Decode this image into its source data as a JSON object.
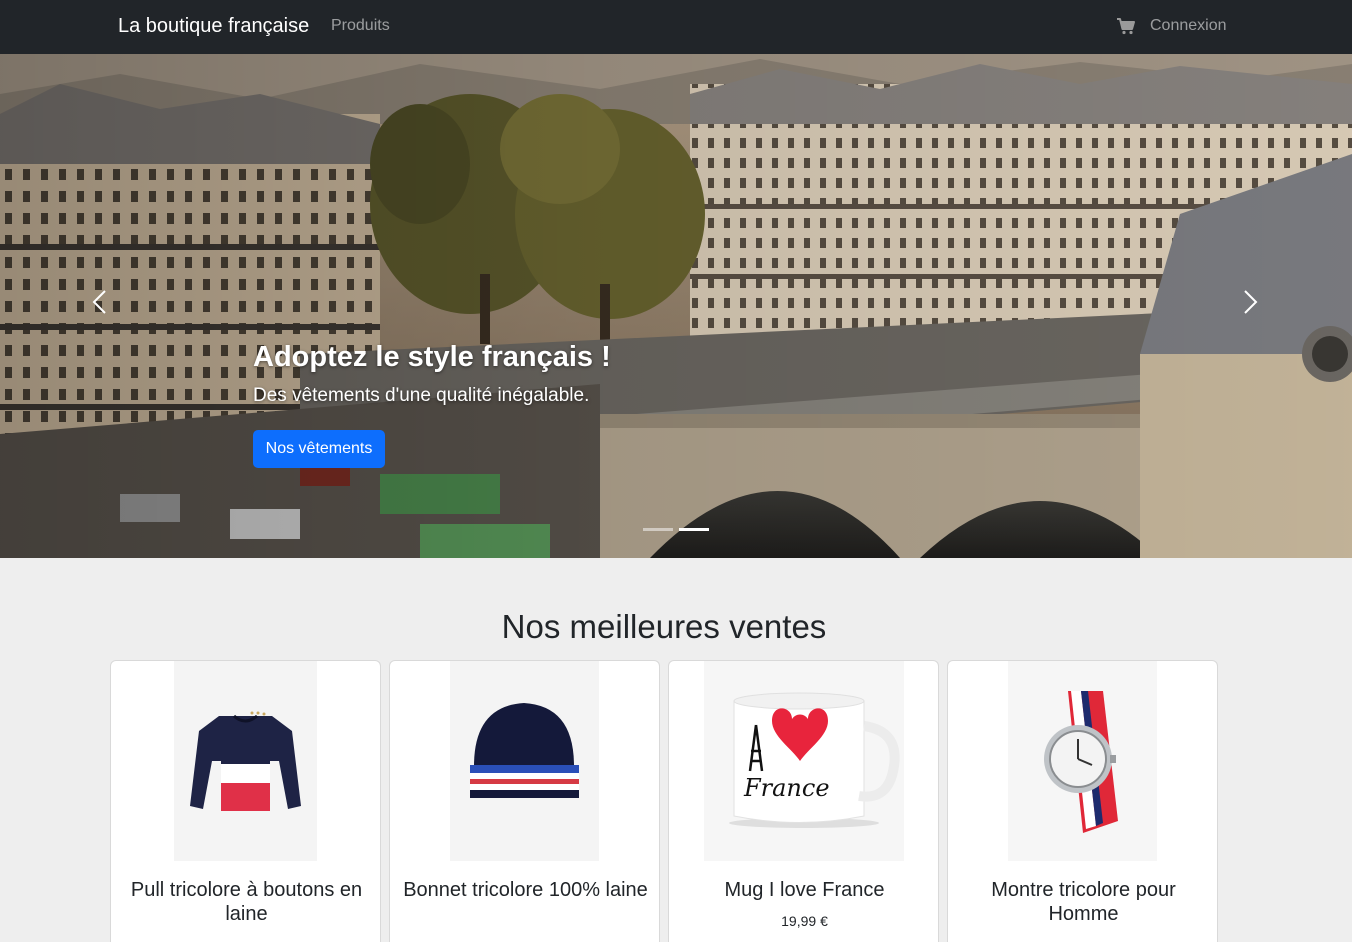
{
  "navbar": {
    "brand": "La boutique française",
    "products_link": "Produits",
    "cart_icon": "cart-icon",
    "login_link": "Connexion"
  },
  "hero": {
    "title": "Adoptez le style français !",
    "subtitle": "Des vêtements d'une qualité inégalable.",
    "button": "Nos vêtements",
    "slide_count": 2,
    "active_slide": 2
  },
  "bestsellers": {
    "title": "Nos meilleures ventes",
    "products": [
      {
        "name": "Pull tricolore à boutons en laine",
        "price": "",
        "image": "sweater-image"
      },
      {
        "name": "Bonnet tricolore 100% laine",
        "price": "",
        "image": "beanie-image"
      },
      {
        "name": "Mug I love France",
        "price": "19,99 €",
        "image": "mug-image"
      },
      {
        "name": "Montre tricolore pour Homme",
        "price": "",
        "image": "watch-image"
      }
    ]
  },
  "colors": {
    "navbar": "#212529",
    "primary": "#0d6efd",
    "page_bg": "#eeeeee"
  }
}
